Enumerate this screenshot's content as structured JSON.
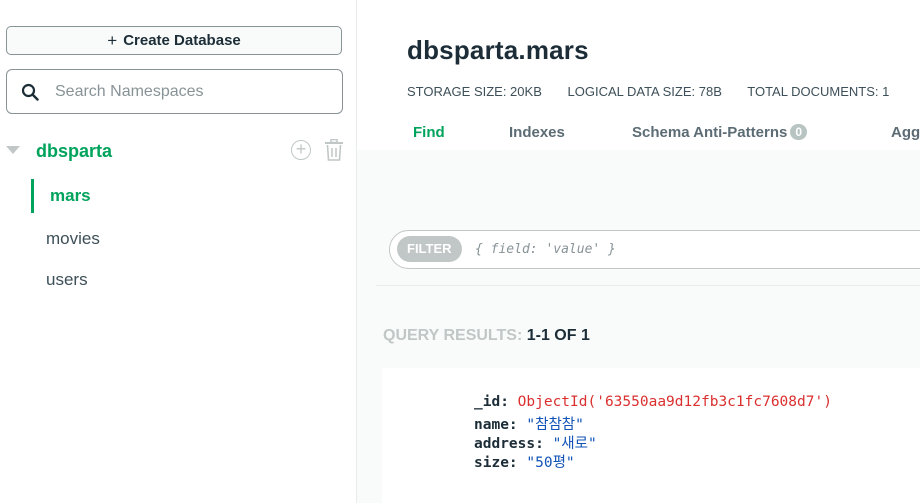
{
  "sidebar": {
    "create_label": "Create Database",
    "search_placeholder": "Search Namespaces",
    "database": "dbsparta",
    "collections": [
      "mars",
      "movies",
      "users"
    ]
  },
  "main": {
    "title": "dbsparta.mars",
    "stats": {
      "storage": "STORAGE SIZE: 20KB",
      "logical": "LOGICAL DATA SIZE: 78B",
      "docs": "TOTAL DOCUMENTS: 1"
    },
    "tabs": {
      "find": "Find",
      "indexes": "Indexes",
      "schema": "Schema Anti-Patterns",
      "schema_badge": "0",
      "agg": "Agg"
    },
    "filter": {
      "label": "FILTER",
      "placeholder": "{ field: 'value' }"
    },
    "results": {
      "label": "QUERY RESULTS:",
      "count": "1-1 OF 1"
    },
    "document": {
      "id_key": "_id:",
      "id_val": "ObjectId('63550aa9d12fb3c1fc7608d7')",
      "name_key": "name:",
      "name_val": "\"참참참\"",
      "address_key": "address:",
      "address_val": "\"새로\"",
      "size_key": "size:",
      "size_val": "\"50평\""
    }
  },
  "colors": {
    "accent": "#00a35c",
    "objectid": "#db3030",
    "string": "#1254b7"
  },
  "icons": [
    "plus-icon",
    "search-icon",
    "caret-down-icon",
    "add-circle-icon",
    "trash-icon"
  ]
}
